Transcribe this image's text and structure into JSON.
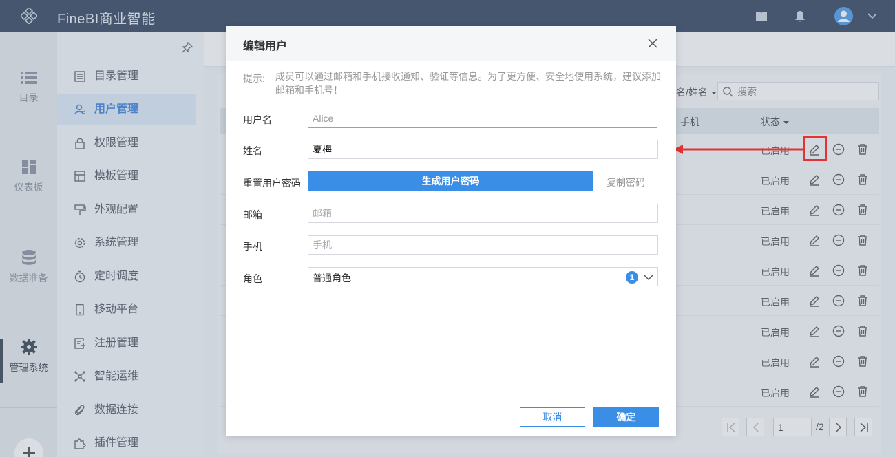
{
  "app": {
    "title": "FineBI商业智能"
  },
  "rail": {
    "items": [
      {
        "label": "目录",
        "icon": "list-icon"
      },
      {
        "label": "仪表板",
        "icon": "dashboard-icon"
      },
      {
        "label": "数据准备",
        "icon": "database-icon"
      },
      {
        "label": "管理系统",
        "icon": "gear-icon"
      }
    ],
    "active": "管理系统"
  },
  "nav": {
    "items": [
      {
        "label": "目录管理",
        "icon": "catalog-icon"
      },
      {
        "label": "用户管理",
        "icon": "user-icon"
      },
      {
        "label": "权限管理",
        "icon": "lock-icon"
      },
      {
        "label": "模板管理",
        "icon": "template-icon"
      },
      {
        "label": "外观配置",
        "icon": "brush-icon"
      },
      {
        "label": "系统管理",
        "icon": "settings-icon"
      },
      {
        "label": "定时调度",
        "icon": "timer-icon"
      },
      {
        "label": "移动平台",
        "icon": "mobile-icon"
      },
      {
        "label": "注册管理",
        "icon": "register-icon"
      },
      {
        "label": "智能运维",
        "icon": "ops-icon"
      },
      {
        "label": "数据连接",
        "icon": "link-icon"
      },
      {
        "label": "插件管理",
        "icon": "plugin-icon"
      }
    ],
    "active": "用户管理"
  },
  "table": {
    "filter_label": "名/姓名",
    "search_placeholder": "搜索",
    "headers": {
      "phone": "手机",
      "status": "状态"
    },
    "rows": [
      "已启用",
      "已启用",
      "已启用",
      "已启用",
      "已启用",
      "已启用",
      "已启用",
      "已启用",
      "已启用"
    ]
  },
  "pagination": {
    "current": "1",
    "total": "/2"
  },
  "modal": {
    "title": "编辑用户",
    "hint_label": "提示:",
    "hint_text": "成员可以通过邮箱和手机接收通知、验证等信息。为了更方便、安全地使用系统，建议添加邮箱和手机号！",
    "username": {
      "label": "用户名",
      "value": "Alice"
    },
    "name": {
      "label": "姓名",
      "value": "夏梅"
    },
    "password": {
      "label": "重置用户密码",
      "generate_label": "生成用户密码",
      "copy_label": "复制密码"
    },
    "email": {
      "label": "邮箱",
      "placeholder": "邮箱"
    },
    "phone": {
      "label": "手机",
      "placeholder": "手机"
    },
    "role": {
      "label": "角色",
      "value": "普通角色",
      "count": "1"
    },
    "cancel_label": "取消",
    "ok_label": "确定"
  },
  "colors": {
    "accent": "#3a8ee6",
    "topbar": "#1c2e4d",
    "annotation": "#e23434"
  }
}
